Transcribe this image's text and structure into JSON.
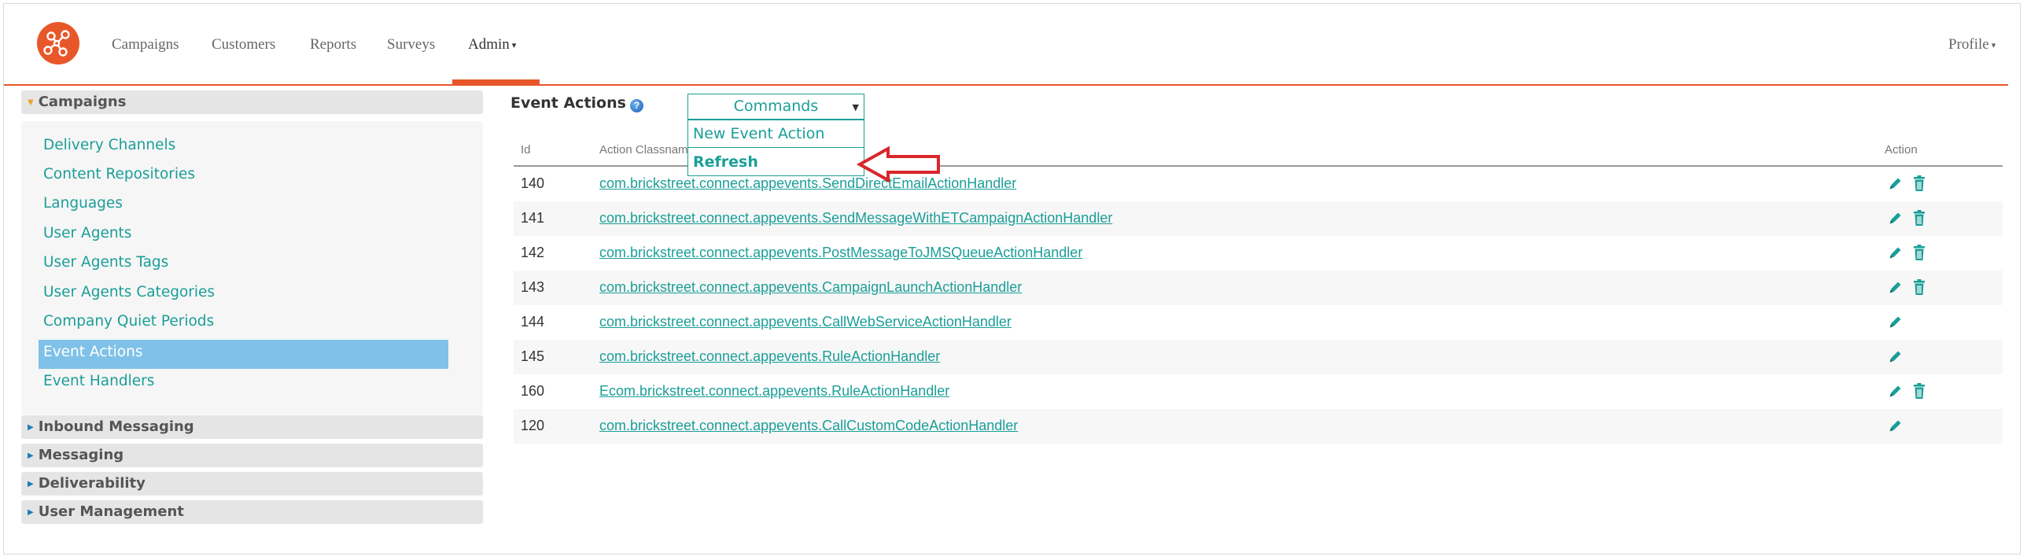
{
  "navbar": {
    "items": [
      {
        "label": "Campaigns"
      },
      {
        "label": "Customers"
      },
      {
        "label": "Reports"
      },
      {
        "label": "Surveys"
      },
      {
        "label": "Admin"
      }
    ],
    "profile_label": "Profile",
    "accent_color": "#e8572a"
  },
  "sidebar": {
    "campaigns_header": "Campaigns",
    "campaign_items": [
      {
        "label": "Delivery Channels"
      },
      {
        "label": "Content Repositories"
      },
      {
        "label": "Languages"
      },
      {
        "label": "User Agents"
      },
      {
        "label": "User Agents Tags"
      },
      {
        "label": "User Agents Categories"
      },
      {
        "label": "Company Quiet Periods"
      },
      {
        "label": "Event Actions"
      },
      {
        "label": "Event Handlers"
      }
    ],
    "active_item": "Event Actions",
    "other_sections": [
      {
        "label": "Inbound Messaging"
      },
      {
        "label": "Messaging"
      },
      {
        "label": "Deliverability"
      },
      {
        "label": "User Management"
      }
    ]
  },
  "main": {
    "title": "Event Actions",
    "help_icon": "?",
    "commands": {
      "label": "Commands",
      "items": [
        {
          "label": "New Event Action"
        },
        {
          "label": "Refresh"
        }
      ]
    },
    "table": {
      "headers": {
        "id": "Id",
        "classname": "Action Classname",
        "action": "Action"
      },
      "rows": [
        {
          "id": "140",
          "classname": "com.brickstreet.connect.appevents.SendDirectEmailActionHandler",
          "deletable": true
        },
        {
          "id": "141",
          "classname": "com.brickstreet.connect.appevents.SendMessageWithETCampaignActionHandler",
          "deletable": true
        },
        {
          "id": "142",
          "classname": "com.brickstreet.connect.appevents.PostMessageToJMSQueueActionHandler",
          "deletable": true
        },
        {
          "id": "143",
          "classname": "com.brickstreet.connect.appevents.CampaignLaunchActionHandler",
          "deletable": true
        },
        {
          "id": "144",
          "classname": "com.brickstreet.connect.appevents.CallWebServiceActionHandler",
          "deletable": false
        },
        {
          "id": "145",
          "classname": "com.brickstreet.connect.appevents.RuleActionHandler",
          "deletable": false
        },
        {
          "id": "160",
          "classname": "Ecom.brickstreet.connect.appevents.RuleActionHandler",
          "deletable": true
        },
        {
          "id": "120",
          "classname": "com.brickstreet.connect.appevents.CallCustomCodeActionHandler",
          "deletable": false
        }
      ]
    }
  }
}
